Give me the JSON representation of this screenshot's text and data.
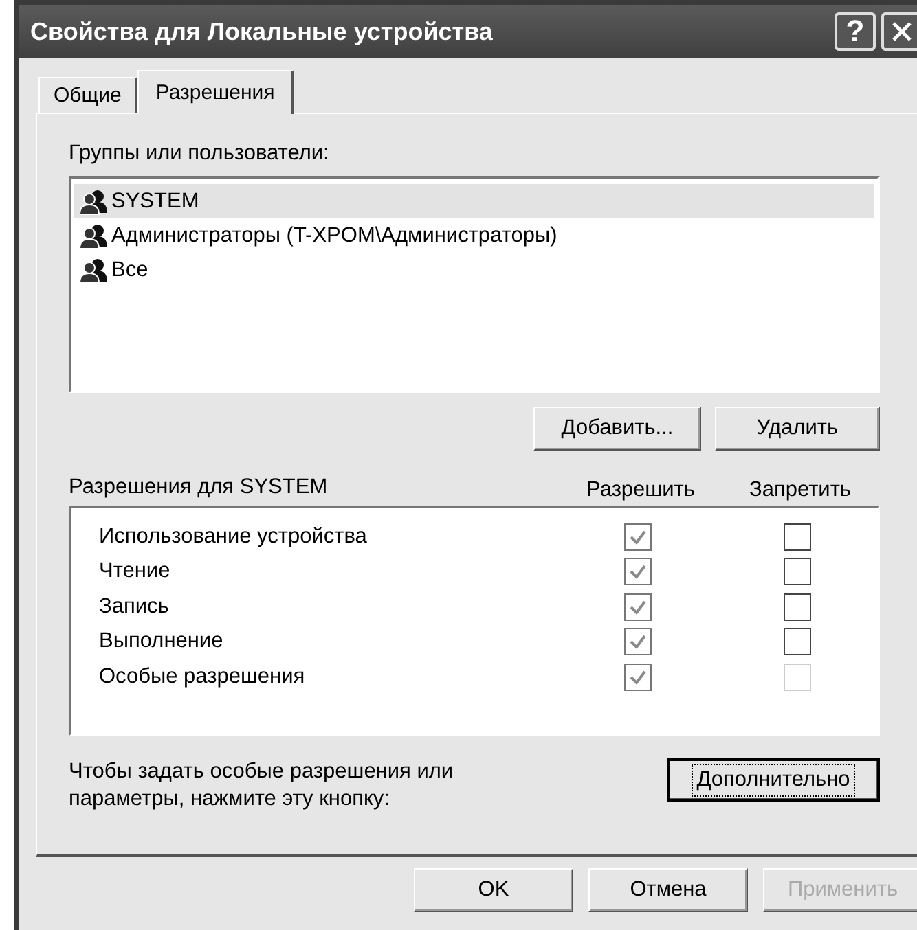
{
  "window": {
    "title": "Свойства для Локальные устройства",
    "help": "?"
  },
  "tabs": [
    {
      "label": "Общие",
      "selected": false
    },
    {
      "label": "Разрешения",
      "selected": true
    }
  ],
  "users": {
    "label": "Группы или пользователи:",
    "items": [
      {
        "name": "SYSTEM",
        "selected": true
      },
      {
        "name": "Администраторы (T-XPOM\\Администраторы)",
        "selected": false
      },
      {
        "name": "Все",
        "selected": false
      }
    ]
  },
  "user_buttons": [
    {
      "label": "Добавить...",
      "disabled": false
    },
    {
      "label": "Удалить",
      "disabled": false
    }
  ],
  "permissions": {
    "label": "Разрешения для SYSTEM",
    "columns": [
      "Разрешить",
      "Запретить"
    ],
    "rows": [
      {
        "name": "Использование устройства",
        "allow": {
          "checked": true,
          "disabled": true
        },
        "deny": {
          "checked": false,
          "disabled": false
        }
      },
      {
        "name": "Чтение",
        "allow": {
          "checked": true,
          "disabled": true
        },
        "deny": {
          "checked": false,
          "disabled": false
        }
      },
      {
        "name": "Запись",
        "allow": {
          "checked": true,
          "disabled": true
        },
        "deny": {
          "checked": false,
          "disabled": false
        }
      },
      {
        "name": "Выполнение",
        "allow": {
          "checked": true,
          "disabled": true
        },
        "deny": {
          "checked": false,
          "disabled": false
        }
      },
      {
        "name": "Особые разрешения",
        "allow": {
          "checked": true,
          "disabled": true
        },
        "deny": {
          "checked": false,
          "disabled": true
        }
      }
    ]
  },
  "advanced": {
    "hint": "Чтобы задать особые разрешения или параметры, нажмите эту кнопку:",
    "button": {
      "label": "Дополнительно",
      "focused": true
    }
  },
  "buttons": [
    {
      "label": "OK",
      "disabled": false
    },
    {
      "label": "Отмена",
      "disabled": false
    },
    {
      "label": "Применить",
      "disabled": true
    }
  ]
}
